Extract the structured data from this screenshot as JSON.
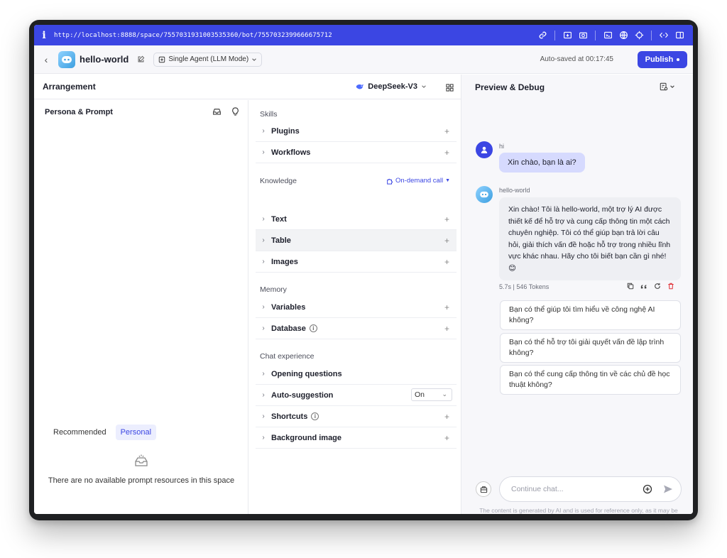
{
  "browser": {
    "url": "http://localhost:8888/space/7557031931003535360/bot/7557032399666675712",
    "info_glyph": "i"
  },
  "header": {
    "back_glyph": "‹",
    "bot_name": "hello-world",
    "mode": "Single Agent (LLM Mode)",
    "autosave": "Auto-saved at 00:17:45",
    "publish_label": "Publish"
  },
  "arrangement": {
    "title": "Arrangement",
    "model": "DeepSeek-V3",
    "persona_title": "Persona & Prompt",
    "prompt_tabs": [
      "Recommended",
      "Personal"
    ],
    "empty_text": "There are no available prompt resources in this space"
  },
  "skills": {
    "sections": [
      {
        "title": "Skills",
        "items": [
          {
            "label": "Plugins",
            "plus": "+"
          },
          {
            "label": "Workflows",
            "plus": "+"
          }
        ]
      },
      {
        "title": "Knowledge",
        "extra": "On-demand call",
        "items": [
          {
            "label": "Text",
            "plus": "+"
          },
          {
            "label": "Table",
            "plus": "+"
          },
          {
            "label": "Images",
            "plus": "+"
          }
        ]
      },
      {
        "title": "Memory",
        "items": [
          {
            "label": "Variables",
            "plus": "+"
          },
          {
            "label": "Database",
            "plus": "+"
          }
        ]
      },
      {
        "title": "Chat experience",
        "items": [
          {
            "label": "Opening questions"
          },
          {
            "label": "Auto-suggestion",
            "select_value": "On"
          },
          {
            "label": "Shortcuts",
            "plus": "+"
          },
          {
            "label": "Background image",
            "plus": "+"
          }
        ]
      }
    ]
  },
  "preview": {
    "title": "Preview & Debug",
    "user_name": "hi",
    "user_message": "Xin chào, bạn là ai?",
    "bot_name": "hello-world",
    "bot_message": "Xin chào! Tôi là hello-world, một trợ lý AI được thiết kế để hỗ trợ và cung cấp thông tin một cách chuyên nghiệp. Tôi có thể giúp bạn trả lời câu hỏi, giải thích vấn đề hoặc hỗ trợ trong nhiều lĩnh vực khác nhau. Hãy cho tôi biết bạn cần gì nhé! 😊",
    "meta": "5.7s  |  546 Tokens",
    "suggestions": [
      "Bạn có thể giúp tôi tìm hiểu về công nghệ AI không?",
      "Bạn có thể hỗ trợ tôi giải quyết vấn đề lập trình không?",
      "Bạn có thể cung cấp thông tin về các chủ đề học thuật không?"
    ],
    "input_placeholder": "Continue chat...",
    "disclaimer": "The content is generated by AI and is used for reference only, as it may be untrue and inaccurate."
  },
  "colors": {
    "accent": "#3b46e3",
    "user_bubble": "#d6dafe",
    "bot_bubble": "#eeeff3",
    "delete": "#e0353b"
  }
}
